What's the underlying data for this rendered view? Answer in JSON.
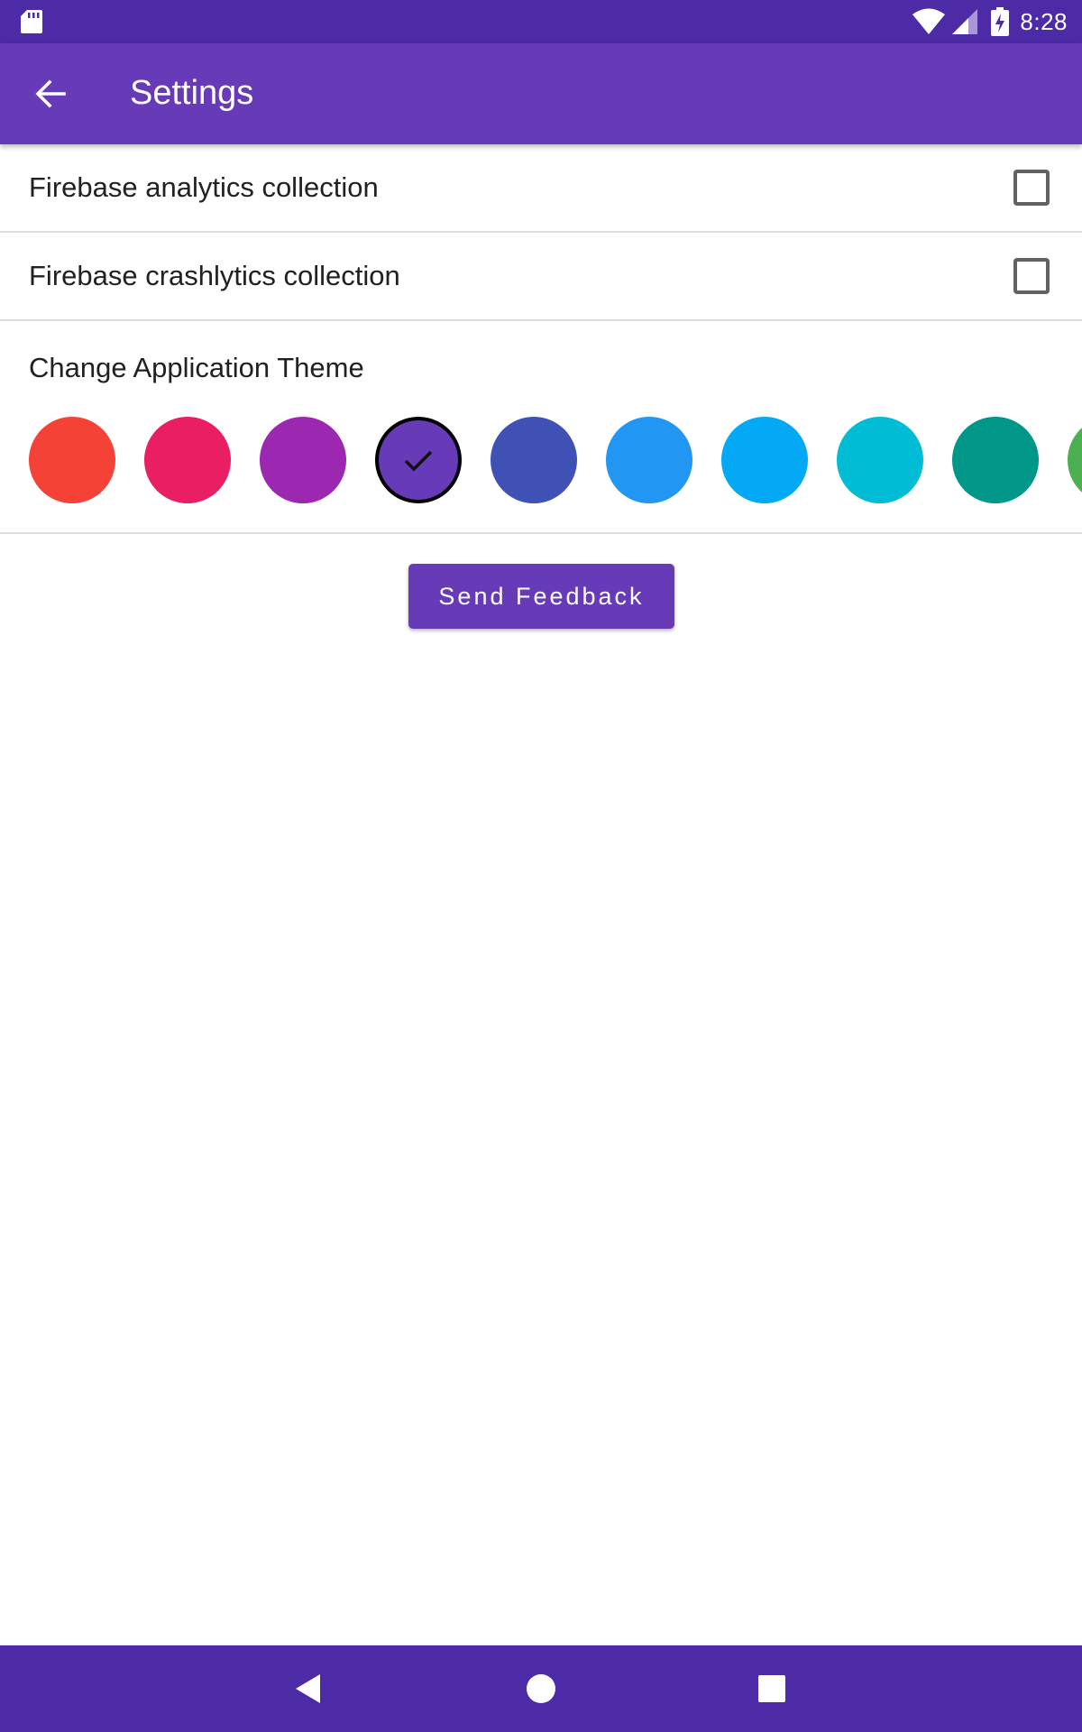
{
  "status_bar": {
    "time": "8:28",
    "icons": [
      "sd-card-icon",
      "wifi-icon",
      "signal-icon",
      "battery-charging-icon"
    ]
  },
  "app_bar": {
    "title": "Settings",
    "back_icon": "arrow-back-icon"
  },
  "settings": [
    {
      "label": "Firebase analytics collection",
      "checked": false
    },
    {
      "label": "Firebase crashlytics collection",
      "checked": false
    }
  ],
  "theme": {
    "label": "Change Application Theme",
    "selected_index": 3,
    "colors": [
      "#f44336",
      "#e91e63",
      "#9c27b0",
      "#673ab7",
      "#3f51b5",
      "#2196f3",
      "#03a9f4",
      "#00bcd4",
      "#009688",
      "#4caf50"
    ]
  },
  "feedback_button": {
    "label": "Send Feedback"
  },
  "nav_bar": {
    "icons": [
      "nav-back-icon",
      "nav-home-icon",
      "nav-recents-icon"
    ]
  },
  "colors": {
    "primary": "#673ab7",
    "primary_dark": "#4d2ba6",
    "text": "#212121",
    "divider": "#dcdcdc"
  }
}
